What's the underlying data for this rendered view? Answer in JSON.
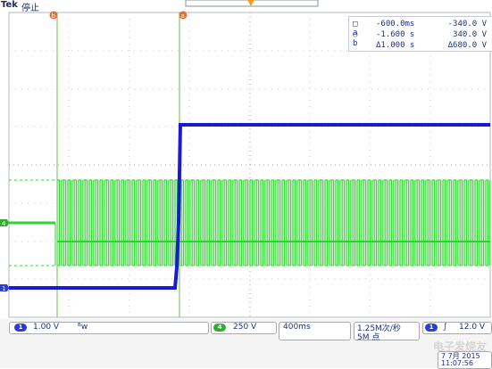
{
  "header": {
    "brand": "Tek",
    "state": "停止"
  },
  "markers": {
    "cursor_a": "a",
    "cursor_b": "b"
  },
  "readout": {
    "row1": {
      "icon": "□ a",
      "t": "-600.0ms",
      "v": "-340.0 V"
    },
    "row2": {
      "icon": "○ b",
      "t": "-1.600 s",
      "v": "340.0 V"
    },
    "row3": {
      "t": "Δ1.000 s",
      "v": "Δ680.0 V"
    }
  },
  "channels": {
    "ch1": {
      "badge": "1",
      "scale": "1.00 V",
      "coupling": "ᴮw"
    },
    "ch4": {
      "badge": "4",
      "scale": "250 V"
    }
  },
  "timebase": {
    "scale": "400ms",
    "rate": "1.25M次/秒",
    "length": "5M 点"
  },
  "trigger": {
    "badge": "1",
    "slope": "∫",
    "level": "12.0 V"
  },
  "date": {
    "day": "7 7月 2015",
    "time": "11:07:56"
  },
  "watermark": "电子发烧友",
  "colors": {
    "ch1": "#1a1ad6",
    "ch4": "#2bd62b",
    "cursor": "#6abf4b",
    "grid": "#9aa0a8"
  }
}
